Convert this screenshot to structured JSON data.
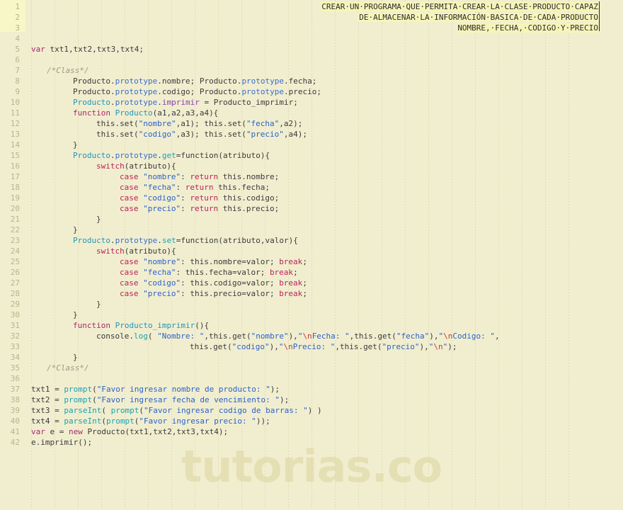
{
  "editor": {
    "title": "JavaScript code editor",
    "language": "JavaScript",
    "watermark": "tutorias.co",
    "background_color": "#f1eed0",
    "gutter_highlight_color": "#f8f7c8",
    "selection_highlight_color": "#f7f4b8",
    "line_number_color": "#b8b48c",
    "caret_color": "#2a2a2a",
    "total_lines": 42,
    "line_height_px": 15,
    "colors": {
      "keyword": "#a52a6a",
      "control_keyword": "#bb2255",
      "class_name": "#2196b8",
      "prototype": "#3b6ecc",
      "member": "#8a3fae",
      "function": "#17a3b0",
      "string": "#2b62c9",
      "escape": "#c43a3a",
      "comment": "#999a88",
      "text": "#3a3a3a"
    }
  },
  "header_comment": {
    "highlighted": true,
    "aligned": "right",
    "lines": [
      "CREAR·UN·PROGRAMA·QUE·PERMITA·CREAR·LA·CLASE·PRODUCTO·CAPAZ",
      "DE·ALMACENAR·LA·INFORMACIÓN·BASICA·DE·CADA·PRODUCTO",
      "NOMBRE,·FECHA,·CODIGO·Y·PRECIO"
    ],
    "plain_lines": [
      "CREAR UN PROGRAMA QUE PERMITA CREAR LA CLASE PRODUCTO CAPAZ",
      "DE ALMACENAR LA INFORMACIÓN BASICA DE CADA PRODUCTO",
      "NOMBRE, FECHA, CODIGO Y PRECIO"
    ]
  },
  "line_numbers": [
    1,
    2,
    3,
    4,
    5,
    6,
    7,
    8,
    9,
    10,
    11,
    12,
    13,
    14,
    15,
    16,
    17,
    18,
    19,
    20,
    21,
    22,
    23,
    24,
    25,
    26,
    27,
    28,
    29,
    30,
    31,
    32,
    33,
    34,
    35,
    36,
    37,
    38,
    39,
    40,
    41,
    42
  ],
  "code_lines": {
    "l5": "var txt1,txt2,txt3,txt4;",
    "l7": "/*Class*/",
    "l8": "Producto.prototype.nombre; Producto.prototype.fecha;",
    "l9": "Producto.prototype.codigo; Producto.prototype.precio;",
    "l10": "Producto.prototype.imprimir = Producto_imprimir;",
    "l11": "function Producto(a1,a2,a3,a4){",
    "l12": "this.set(\"nombre\",a1); this.set(\"fecha\",a2);",
    "l13": "this.set(\"codigo\",a3); this.set(\"precio\",a4);",
    "l14": "}",
    "l15": "Producto.prototype.get=function(atributo){",
    "l16": "switch(atributo){",
    "l17": "case \"nombre\": return this.nombre;",
    "l18": "case \"fecha\": return this.fecha;",
    "l19": "case \"codigo\": return this.codigo;",
    "l20": "case \"precio\": return this.precio;",
    "l21": "}",
    "l22": "}",
    "l23": "Producto.prototype.set=function(atributo,valor){",
    "l24": "switch(atributo){",
    "l25": "case \"nombre\": this.nombre=valor; break;",
    "l26": "case \"fecha\": this.fecha=valor; break;",
    "l27": "case \"codigo\": this.codigo=valor; break;",
    "l28": "case \"precio\": this.precio=valor; break;",
    "l29": "}",
    "l30": "}",
    "l31": "function Producto_imprimir(){",
    "l32": "console.log( \"Nombre: \",this.get(\"nombre\"),\"\\nFecha: \",this.get(\"fecha\"),\"\\nCodigo: \",",
    "l33": "this.get(\"codigo\"),\"\\nPrecio: \",this.get(\"precio\"),\"\\n\");",
    "l34": "}",
    "l35": "/*Class*/",
    "l37": "txt1 = prompt(\"Favor ingresar nombre de producto: \");",
    "l38": "txt2 = prompt(\"Favor ingresar fecha de vencimiento: \");",
    "l39": "txt3 = parseInt( prompt(\"Favor ingresar codigo de barras: \") )",
    "l40": "txt4 = parseInt(prompt(\"Favor ingresar precio: \"));",
    "l41": "var e = new Producto(txt1,txt2,txt3,txt4);",
    "l42": "e.imprimir();"
  }
}
